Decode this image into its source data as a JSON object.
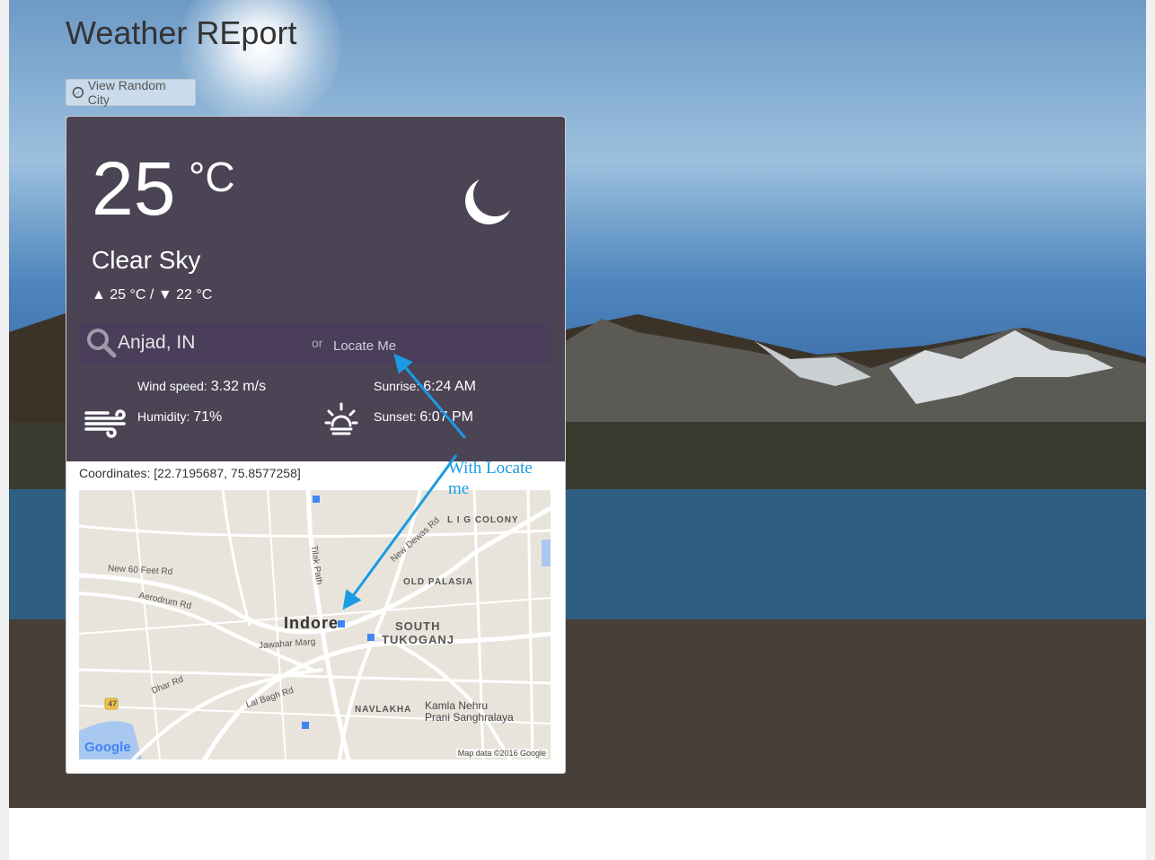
{
  "page": {
    "title": "Weather REport"
  },
  "random_button": {
    "label": "View Random City",
    "icon": "compass-icon"
  },
  "weather": {
    "temperature": "25",
    "unit": "°C",
    "condition": "Clear Sky",
    "min_max": "▲ 25 °C / ▼ 22 °C",
    "condition_icon": "moon-icon"
  },
  "search": {
    "city_value": "Anjad, IN",
    "or_text": "or",
    "locate_label": "Locate Me"
  },
  "details": {
    "wind_label": "Wind speed:",
    "wind_value": "3.32 m/s",
    "humidity_label": "Humidity:",
    "humidity_value": "71%",
    "sunrise_label": "Sunrise:",
    "sunrise_value": "6:24 AM",
    "sunset_label": "Sunset:",
    "sunset_value": "6:07 PM"
  },
  "coordinates": "Coordinates: [22.7195687, 75.8577258]",
  "map": {
    "labels": {
      "lig_colony": "L I G COLONY",
      "new_dewas": "New Dewas Rd",
      "tilak_path": "Tilak Path",
      "new60": "New 60 Feet Rd",
      "aerodrum": "Aerodrum Rd",
      "old_palasia": "OLD PALASIA",
      "indore": "Indore",
      "south": "SOUTH",
      "tukoganj": "TUKOGANJ",
      "jawahar": "Jawahar Marg",
      "dhar": "Dhar Rd",
      "lal_bagh": "Lal Bagh Rd",
      "navlakha": "NAVLAKHA",
      "kamla1": "Kamla Nehru",
      "kamla2": "Prani Sanghralaya",
      "shield": "47"
    },
    "logo": "Google",
    "attribution": "Map data ©2016 Google"
  },
  "annotation": {
    "text": "With Locate me",
    "color": "#1a9be3"
  },
  "colors": {
    "card": "#4b4455",
    "search_bar": "#4a3e5a",
    "annotation": "#1a9be3"
  }
}
